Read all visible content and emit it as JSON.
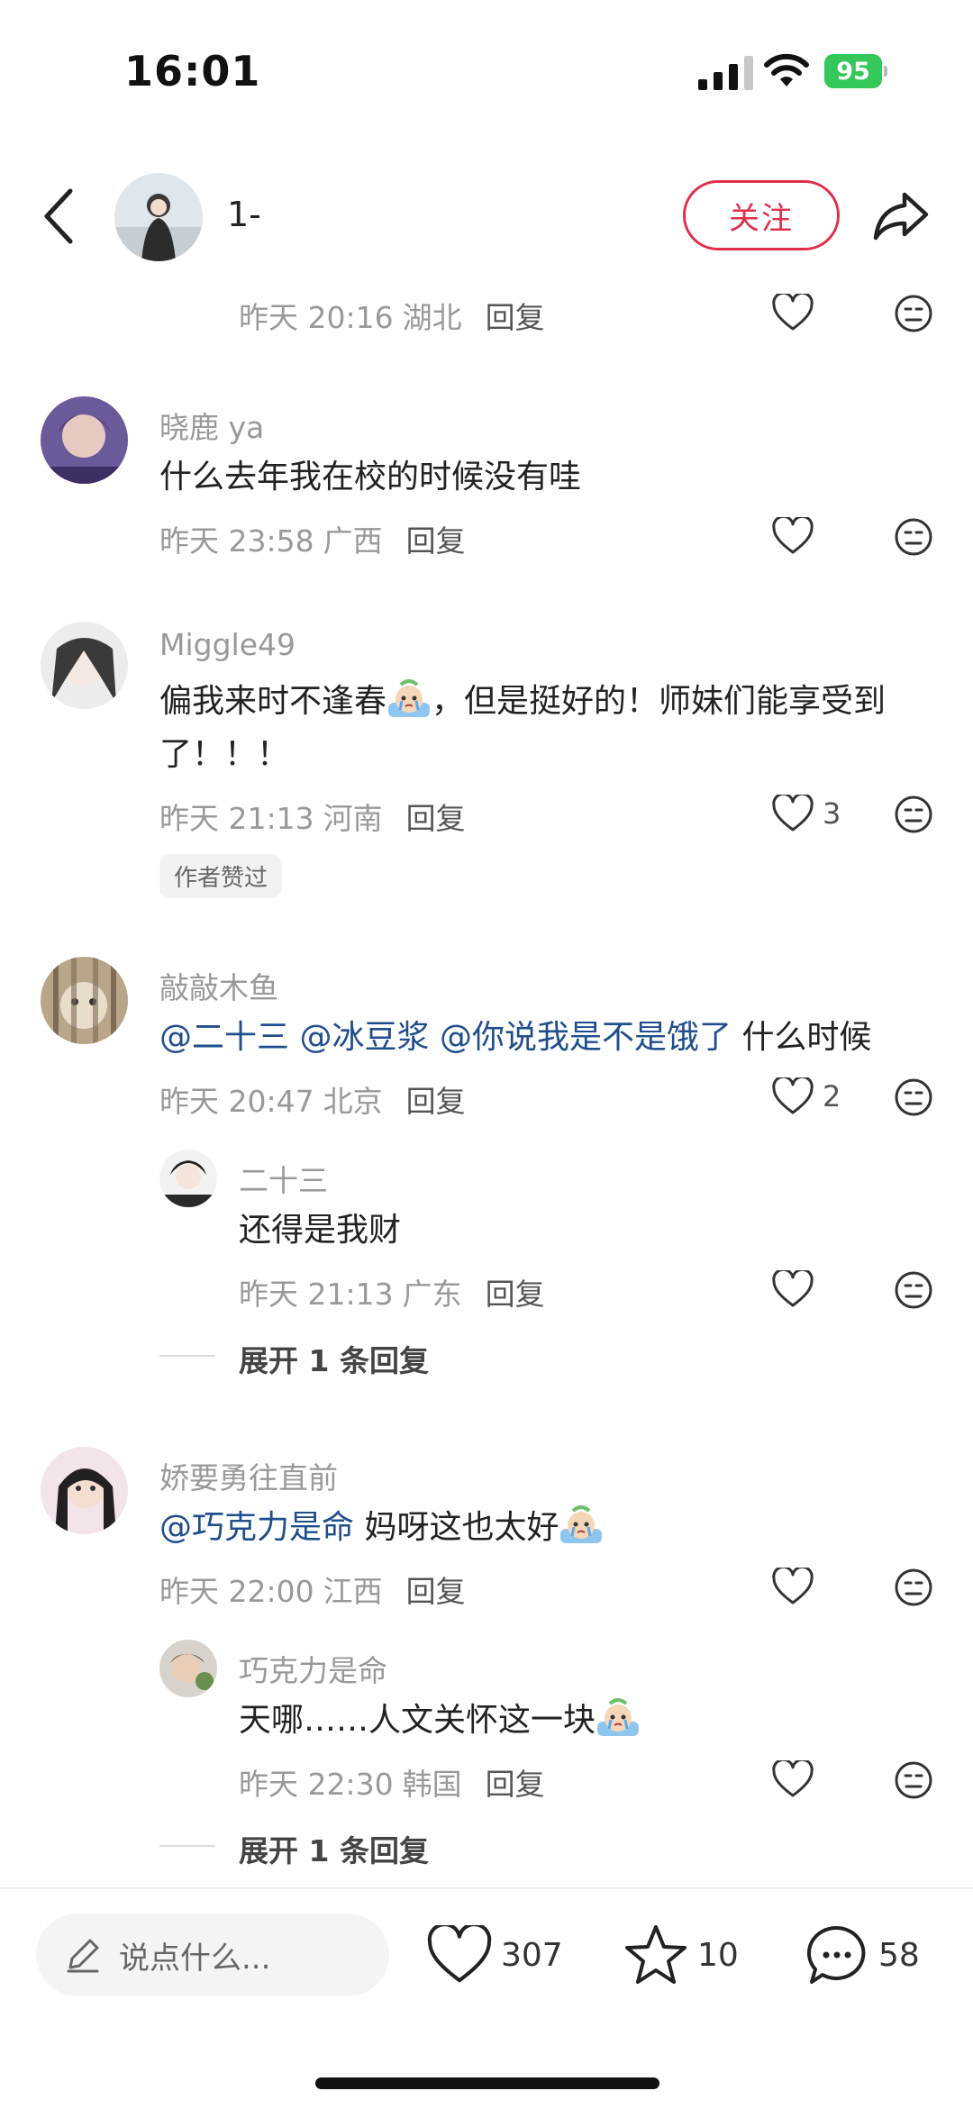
{
  "status_bar": {
    "time": "16:01",
    "battery": "95"
  },
  "header": {
    "author_name": "1-",
    "follow_label": "关注"
  },
  "top_meta": {
    "time": "昨天 20:16",
    "location": "湖北",
    "reply": "回复"
  },
  "comments": [
    {
      "user": "晓鹿 ya",
      "text": "什么去年我在校的时候没有哇",
      "time": "昨天 23:58",
      "location": "广西",
      "reply": "回复",
      "likes": ""
    },
    {
      "user": "Miggle49",
      "text1": "偏我来时不逢春",
      "text1b": "，但是挺好的！师妹们能享受到",
      "text2": "了！！！",
      "time": "昨天 21:13",
      "location": "河南",
      "reply": "回复",
      "likes": "3",
      "badge": "作者赞过"
    },
    {
      "user": "敲敲木鱼",
      "mention1": "@二十三",
      "mention2": "@冰豆浆",
      "mention3": "@你说我是不是饿了",
      "text_tail": " 什么时候",
      "time": "昨天 20:47",
      "location": "北京",
      "reply": "回复",
      "likes": "2",
      "sub": {
        "user": "二十三",
        "text": "还得是我财",
        "time": "昨天 21:13",
        "location": "广东",
        "reply": "回复"
      },
      "expand": "展开 1 条回复"
    },
    {
      "user": "娇要勇往直前",
      "mention": "@巧克力是命",
      "text": " 妈呀这也太好",
      "time": "昨天 22:00",
      "location": "江西",
      "reply": "回复",
      "likes": "",
      "sub": {
        "user": "巧克力是命",
        "text": "天哪……人文关怀这一块",
        "time": "昨天 22:30",
        "location": "韩国",
        "reply": "回复"
      },
      "expand": "展开 1 条回复"
    }
  ],
  "bottom_bar": {
    "placeholder": "说点什么...",
    "likes": "307",
    "stars": "10",
    "comments": "58"
  },
  "colors": {
    "accent": "#e02e4b",
    "mention": "#1f4e8c",
    "battery": "#34c759"
  },
  "icons": [
    "back-icon",
    "share-icon",
    "heart-icon",
    "dislike-face-icon",
    "pencil-icon",
    "star-icon",
    "comment-bubble-icon",
    "crying-emoji-icon"
  ]
}
